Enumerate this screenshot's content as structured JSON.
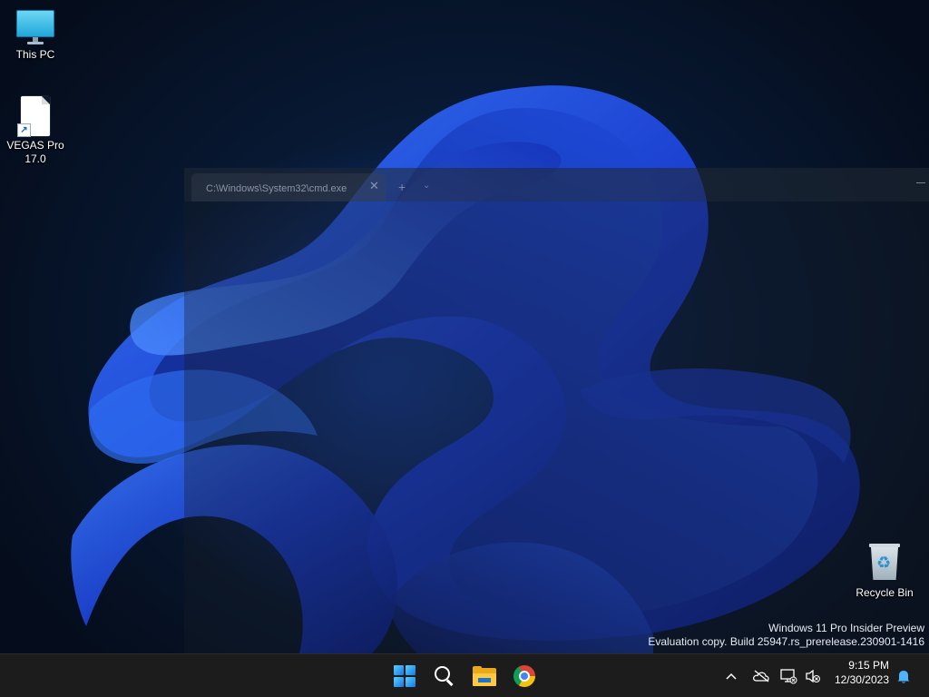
{
  "desktop": {
    "icons": [
      {
        "label": "This PC",
        "icon": "monitor-icon"
      },
      {
        "label": "VEGAS Pro 17.0",
        "icon": "shortcut-file-icon"
      },
      {
        "label": "Recycle Bin",
        "icon": "recycle-bin-icon"
      }
    ],
    "watermark_line1": "Windows 11 Pro Insider Preview",
    "watermark_line2": "Evaluation copy. Build 25947.rs_prerelease.230901-1416"
  },
  "cmd_window": {
    "tab_title": "C:\\Windows\\System32\\cmd.exe",
    "close_glyph": "✕",
    "new_tab_glyph": "+",
    "dropdown_glyph": "⌄"
  },
  "taskbar": {
    "apps": [
      {
        "name": "Start",
        "icon": "windows-start-icon"
      },
      {
        "name": "Search",
        "icon": "search-icon"
      },
      {
        "name": "File Explorer",
        "icon": "folder-icon"
      },
      {
        "name": "Google Chrome",
        "icon": "chrome-icon"
      }
    ],
    "tray": {
      "chevron_glyph": "^",
      "time": "9:15 PM",
      "date": "12/30/2023"
    }
  },
  "colors": {
    "taskbar_bg": "#1c1c1c",
    "wallpaper_accent": "#1e4fe0"
  }
}
